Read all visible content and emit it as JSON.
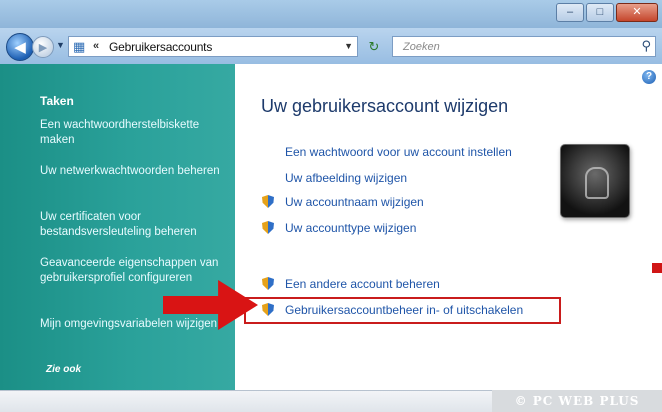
{
  "address_bar": {
    "separator": "«",
    "path": "Gebruikersaccounts"
  },
  "search": {
    "placeholder": "Zoeken"
  },
  "sidebar": {
    "title": "Taken",
    "links": [
      "Een wachtwoordherstelbiskette maken",
      "Uw netwerkwachtwoorden beheren",
      "Uw certificaten voor bestandsversleuteling beheren",
      "Geavanceerde eigenschappen van gebruikersprofiel configureren",
      "Mijn omgevingsvariabelen wijzigen"
    ],
    "more": "Zie ook"
  },
  "main": {
    "title": "Uw gebruikersaccount wijzigen",
    "links": [
      "Een wachtwoord voor uw account instellen",
      "Uw afbeelding wijzigen",
      "Uw accountnaam wijzigen",
      "Uw accounttype wijzigen",
      "Een andere account beheren",
      "Gebruikersaccountbeheer in- of uitschakelen"
    ]
  },
  "watermark": "© PC WEB PLUS",
  "colors": {
    "sidebar": "#2aa19a",
    "link": "#1f55a8",
    "highlight": "#c91c1c",
    "arrow": "#d91414"
  },
  "icons": {
    "back": "back-arrow-icon",
    "forward": "forward-arrow-icon",
    "folder": "user-accounts-icon",
    "refresh": "refresh-icon",
    "search": "search-icon",
    "help": "help-icon",
    "shield": "uac-shield-icon"
  }
}
